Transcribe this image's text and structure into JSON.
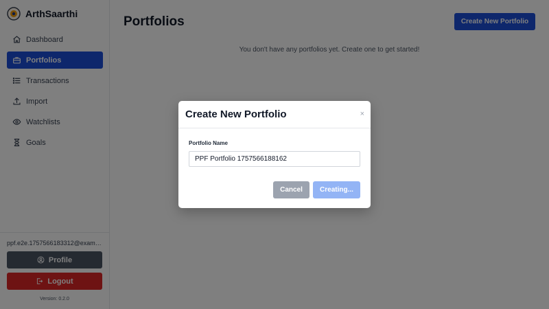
{
  "app": {
    "name": "ArthSaarthi"
  },
  "sidebar": {
    "items": [
      {
        "label": "Dashboard",
        "icon": "home-icon",
        "active": false
      },
      {
        "label": "Portfolios",
        "icon": "briefcase-icon",
        "active": true
      },
      {
        "label": "Transactions",
        "icon": "list-icon",
        "active": false
      },
      {
        "label": "Import",
        "icon": "upload-icon",
        "active": false
      },
      {
        "label": "Watchlists",
        "icon": "eye-icon",
        "active": false
      },
      {
        "label": "Goals",
        "icon": "hourglass-icon",
        "active": false
      }
    ],
    "user_email": "ppf.e2e.1757566183312@examp...",
    "profile_label": "Profile",
    "logout_label": "Logout",
    "version": "Version: 0.2.0"
  },
  "main": {
    "title": "Portfolios",
    "create_button_label": "Create New Portfolio",
    "empty_message": "You don't have any portfolios yet. Create one to get started!"
  },
  "modal": {
    "title": "Create New Portfolio",
    "close_symbol": "×",
    "field_label": "Portfolio Name",
    "field_value": "PPF Portfolio 1757566188162",
    "cancel_label": "Cancel",
    "submit_label": "Creating..."
  },
  "colors": {
    "accent": "#1d4ed8",
    "danger": "#dc2626",
    "secondary": "#4b5563",
    "submit_disabled": "#93b4f5"
  }
}
